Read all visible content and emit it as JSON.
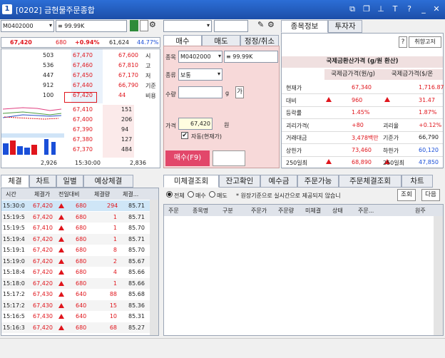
{
  "window": {
    "num": "1",
    "title": "[0202] 금현물주문종합"
  },
  "left": {
    "code": "M0402000",
    "name": "≡  99.99K",
    "price": "67,420",
    "change": "680",
    "rate": "+0.94%",
    "volume": "61,624",
    "ratio": "44.77%",
    "asks": [
      {
        "q": "503",
        "p": "67,470"
      },
      {
        "q": "536",
        "p": "67,460"
      },
      {
        "q": "447",
        "p": "67,450"
      },
      {
        "q": "912",
        "p": "67,440"
      },
      {
        "q": "100",
        "p": "67,420"
      }
    ],
    "askInfo": [
      {
        "v": "67,600",
        "l": "시"
      },
      {
        "v": "67,810",
        "l": "고"
      },
      {
        "v": "67,170",
        "l": "저"
      },
      {
        "v": "66,790",
        "l": "기준"
      },
      {
        "v": "44",
        "l": "비용"
      }
    ],
    "bids": [
      {
        "p": "67,410",
        "q": "151"
      },
      {
        "p": "67,400",
        "q": "206"
      },
      {
        "p": "67,390",
        "q": "94"
      },
      {
        "p": "67,380",
        "q": "127"
      },
      {
        "p": "67,370",
        "q": "484"
      }
    ],
    "totAsk": "2,926",
    "time": "15:30:00",
    "totBid": "2,836"
  },
  "order": {
    "tabs": [
      "매수",
      "매도",
      "정정/취소"
    ],
    "codeLabel": "종목",
    "code": "M0402000",
    "name": "≡  99.99K",
    "typeLabel": "종류",
    "type": "보통",
    "qtyLabel": "수량",
    "unit": "g",
    "avail": "가",
    "priceLabel": "가격",
    "price": "67,420",
    "won": "원",
    "auto": "자동(현재가)",
    "btn": "매수(F9)"
  },
  "info": {
    "tabs": [
      "종목정보",
      "투자자"
    ],
    "help": "?",
    "btn": "취향고저",
    "header": "국제금환산가격 (g/원 환산)",
    "col1": "국제금가격(원/g)",
    "col2": "국제금가격($/온",
    "rows": [
      {
        "l": "현재가",
        "v": "67,340",
        "l2": "",
        "v2": "1,716.87"
      },
      {
        "l": "대비",
        "v": "960",
        "l2": "",
        "v2": "31.47"
      },
      {
        "l": "등락률",
        "v": "1.45%",
        "l2": "",
        "v2": "1.87%"
      },
      {
        "l": "괴리가격(",
        "v": "+80",
        "l2": "괴리율",
        "v2": "+0.12%"
      },
      {
        "l": "거래대금",
        "v": "3,478백만",
        "l2": "기준가",
        "v2": "66,790"
      },
      {
        "l": "상한가",
        "v": "73,460",
        "l2": "하한가",
        "v2": "60,120"
      },
      {
        "l": "250일최",
        "v": "68,890",
        "l2": "250일최",
        "v2": "47,850"
      }
    ]
  },
  "trades": {
    "tabs": [
      "체결",
      "차트",
      "일별",
      "예상체결"
    ],
    "cols": [
      "시간",
      "체결가",
      "전일대비",
      "체결량",
      "체결..."
    ],
    "rows": [
      [
        "15:30:0",
        "67,420",
        "680",
        "294",
        "85.71"
      ],
      [
        "15:19:5",
        "67,420",
        "680",
        "1",
        "85.71"
      ],
      [
        "15:19:5",
        "67,410",
        "680",
        "1",
        "85.70"
      ],
      [
        "15:19:4",
        "67,420",
        "680",
        "1",
        "85.71"
      ],
      [
        "15:19:1",
        "67,420",
        "680",
        "8",
        "85.70"
      ],
      [
        "15:19:0",
        "67,420",
        "680",
        "2",
        "85.67"
      ],
      [
        "15:18:4",
        "67,420",
        "680",
        "4",
        "85.66"
      ],
      [
        "15:18:0",
        "67,420",
        "680",
        "1",
        "85.66"
      ],
      [
        "15:17:2",
        "67,430",
        "640",
        "88",
        "85.68"
      ],
      [
        "15:17:2",
        "67,430",
        "640",
        "15",
        "85.36"
      ],
      [
        "15:16:5",
        "67,430",
        "640",
        "10",
        "85.31"
      ],
      [
        "15:16:3",
        "67,420",
        "680",
        "68",
        "85.27"
      ]
    ]
  },
  "orders": {
    "tabs": [
      "미체결조회",
      "잔고확인",
      "예수금",
      "주문가능",
      "주문체결조회",
      "차트"
    ],
    "radios": [
      "전체",
      "매수",
      "매도"
    ],
    "note": "* 원장기준으로 실시간으로 제공되지 않습니",
    "btn1": "조회",
    "btn2": "다음",
    "cols": [
      "주문",
      "종목명",
      "구분",
      "주문가",
      "주문량",
      "미체결",
      "상태",
      "주문...",
      "원주"
    ]
  },
  "colors": {
    "red": "#e0151c",
    "blue": "#1a4fd8",
    "title": "#2c6ed6"
  }
}
